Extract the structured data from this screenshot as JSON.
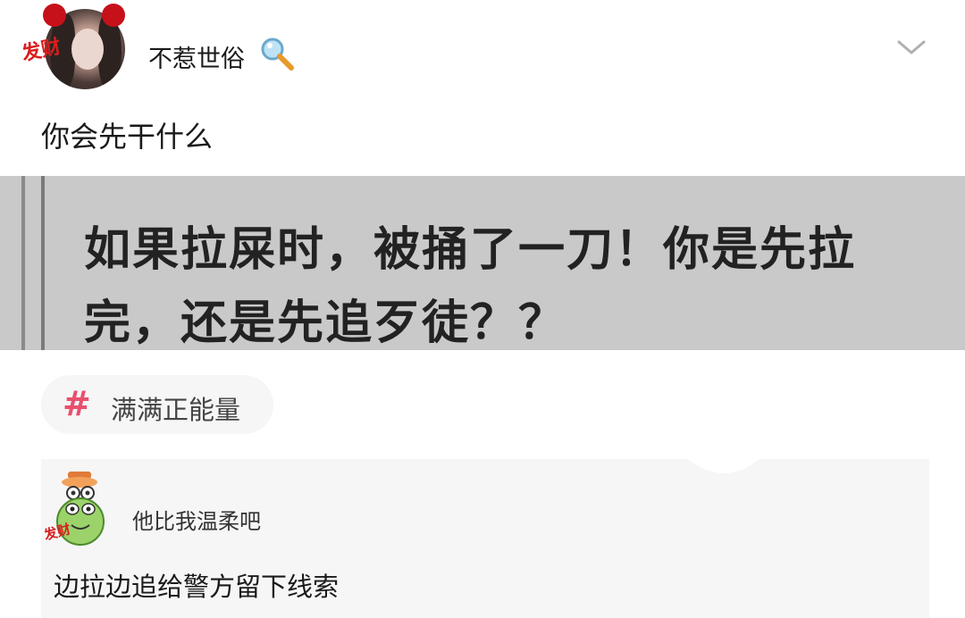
{
  "post": {
    "username": "不惹世俗",
    "avatar_badge": "发财",
    "text": "你会先干什么",
    "image_text_line1": "如果拉屎时，被捅了一刀！你是先拉",
    "image_text_line2": "完，还是先追歹徒？？"
  },
  "tag": {
    "hash": "#",
    "label": "满满正能量"
  },
  "comment": {
    "author": "他比我温柔吧",
    "avatar_badge": "发财",
    "text": "边拉边追给警方留下线索"
  },
  "icons": {
    "magnifier": "magnifier-emoji-icon",
    "chevron": "chevron-down-icon"
  },
  "colors": {
    "hashtag": "#e8506e",
    "badge_red": "#d81e1e"
  }
}
